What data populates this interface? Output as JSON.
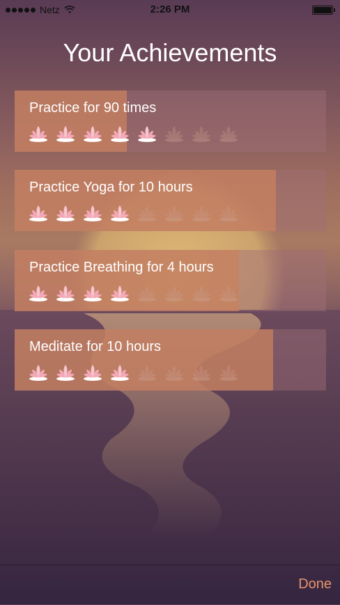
{
  "status_bar": {
    "carrier": "Netz",
    "time": "2:26 PM"
  },
  "page_title": "Your Achievements",
  "achievements": [
    {
      "title": "Practice for 90 times",
      "progress": 0.36,
      "filled_lotus": 5,
      "total_lotus": 8
    },
    {
      "title": "Practice Yoga for 10 hours",
      "progress": 0.84,
      "filled_lotus": 4,
      "total_lotus": 8
    },
    {
      "title": "Practice Breathing for 4 hours",
      "progress": 0.72,
      "filled_lotus": 4,
      "total_lotus": 8
    },
    {
      "title": "Meditate for 10 hours",
      "progress": 0.83,
      "filled_lotus": 4,
      "total_lotus": 8
    }
  ],
  "done_label": "Done",
  "icons": {
    "lotus": "lotus-icon",
    "wifi": "wifi-icon",
    "battery": "battery-icon",
    "signal": "signal-icon"
  },
  "colors": {
    "accent": "#e8946a",
    "progress_fill": "#c8825f"
  }
}
